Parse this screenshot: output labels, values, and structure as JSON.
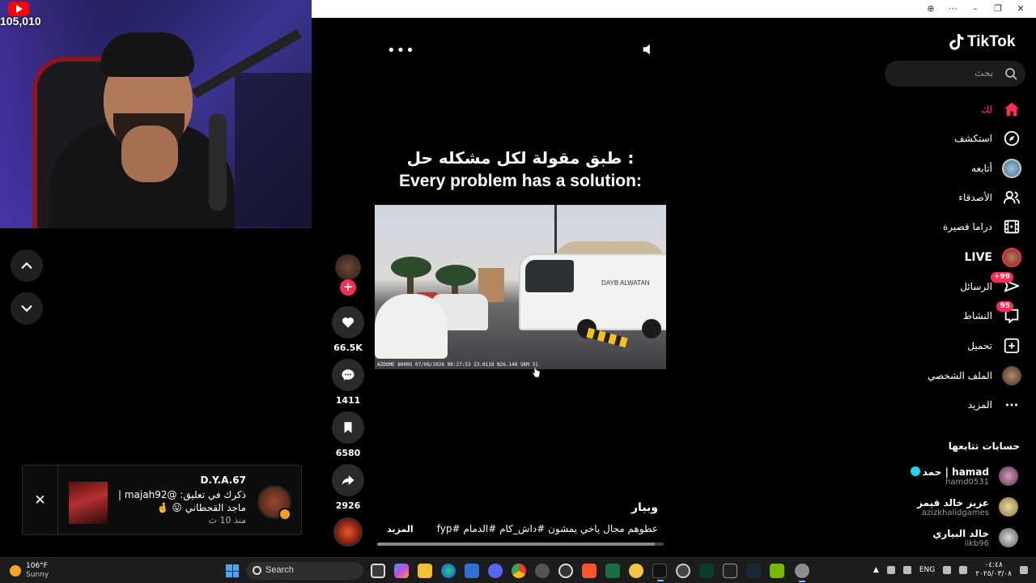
{
  "overlay": {
    "youtube_viewers": "105,010"
  },
  "video": {
    "caption_ar": "طبق مقولة لكل مشكله حل :",
    "caption_en": "Every problem has a solution:",
    "author": "وبيار",
    "description": "عطوهم مجال ياخي يمشون #داش_كام #الدمام #fyp ...",
    "more_label": "المزيد",
    "progress": 0.97,
    "bus_text": "DAYB ALWATAN",
    "dashcam_stamp": "AZDOME 8000S 07/08/2026 08:27:53 23.0118 N26.148 SKM 31",
    "likes": "66.5K",
    "comments": "1411",
    "bookmarks": "6580",
    "shares": "2926"
  },
  "notification": {
    "username": "D.Y.A.67",
    "line1": "ذكرك في تعليق: @majah92 |",
    "line2": "ماجد القحطاني 😛 🤞",
    "time": "منذ 10 ث"
  },
  "sidebar": {
    "logo": "TikTok",
    "search_placeholder": "بحث",
    "nav": [
      {
        "label": "لك",
        "icon": "home-icon"
      },
      {
        "label": "استكشف",
        "icon": "compass-icon"
      },
      {
        "label": "أتابعه",
        "icon": "following-avatar"
      },
      {
        "label": "الأصدقاء",
        "icon": "friends-icon"
      },
      {
        "label": "دراما قصيرة",
        "icon": "film-icon"
      },
      {
        "label": "LIVE",
        "icon": "live-avatar"
      },
      {
        "label": "الرسائل",
        "icon": "messages-icon",
        "badge": "+99"
      },
      {
        "label": "النشاط",
        "icon": "activity-icon",
        "badge": "95"
      },
      {
        "label": "تحميل",
        "icon": "upload-icon"
      },
      {
        "label": "الملف الشخصي",
        "icon": "profile-avatar"
      },
      {
        "label": "المزيد",
        "icon": "more-icon"
      }
    ],
    "following_title": "حسابات تتابعها",
    "following": [
      {
        "name": "حمد | hamad",
        "handle": "hamd0531",
        "verified": true
      },
      {
        "name": "عزيز خالد قيمز",
        "handle": "azizkhalidgames",
        "verified": false
      },
      {
        "name": "خالد البياري",
        "handle": "iikb96",
        "verified": false
      }
    ]
  },
  "taskbar": {
    "temperature": "106°F",
    "condition": "Sunny",
    "search_placeholder": "Search",
    "language": "ENG",
    "time": "٠٤:٤٨",
    "date": "٢٠٢٥/٠٣/٠٨"
  },
  "colors": {
    "accent": "#fe2c55",
    "background": "#000000",
    "youtube_red": "#ff0000"
  }
}
